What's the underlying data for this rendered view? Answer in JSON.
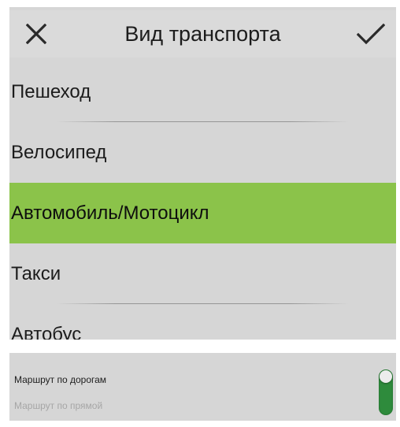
{
  "dialog": {
    "title": "Вид транспорта",
    "close_icon": "close-icon",
    "confirm_icon": "check-icon"
  },
  "transport_options": [
    {
      "label": "Пешеход",
      "selected": false
    },
    {
      "label": "Велосипед",
      "selected": false
    },
    {
      "label": "Автомобиль/Мотоцикл",
      "selected": true
    },
    {
      "label": "Такси",
      "selected": false
    },
    {
      "label": "Автобус",
      "selected": false
    }
  ],
  "route_toggle": {
    "option_on": "Маршрут по дорогам",
    "option_off": "Маршрут по прямой",
    "state": "on"
  },
  "colors": {
    "selected": "#8bc34a",
    "switch": "#2e8b3c",
    "panel": "#d6d6d6"
  }
}
